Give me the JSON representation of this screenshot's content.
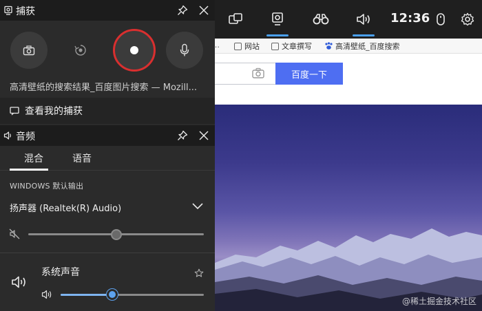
{
  "browser": {
    "bookmarks": [
      "网站",
      "文章撰写",
      "高清壁纸_百度搜索"
    ],
    "search_button": "百度一下",
    "watermark": "@稀土掘金技术社区"
  },
  "topbar": {
    "clock": "12:36",
    "icons": [
      "widget-menu-icon",
      "capture-icon",
      "performance-icon",
      "audio-icon",
      "mouse-icon",
      "gear-icon"
    ]
  },
  "capture": {
    "title": "捕获",
    "page_title": "高清壁纸的搜索结果_百度图片搜索 — Mozill...",
    "view_captures": "查看我的捕获",
    "buttons": [
      "camera-icon",
      "record-last-icon",
      "record-icon",
      "microphone-icon"
    ]
  },
  "audio": {
    "title": "音频",
    "tabs": [
      "混合",
      "语音"
    ],
    "output_label": "WINDOWS 默认输出",
    "device": "扬声器 (Realtek(R) Audio)",
    "device_volume": 0.5,
    "system_sound_label": "系统声音",
    "system_volume": 0.36
  },
  "colors": {
    "accent": "#4aa0f0",
    "record_ring": "#d92f2f",
    "baidu_blue": "#4e6ef2"
  }
}
